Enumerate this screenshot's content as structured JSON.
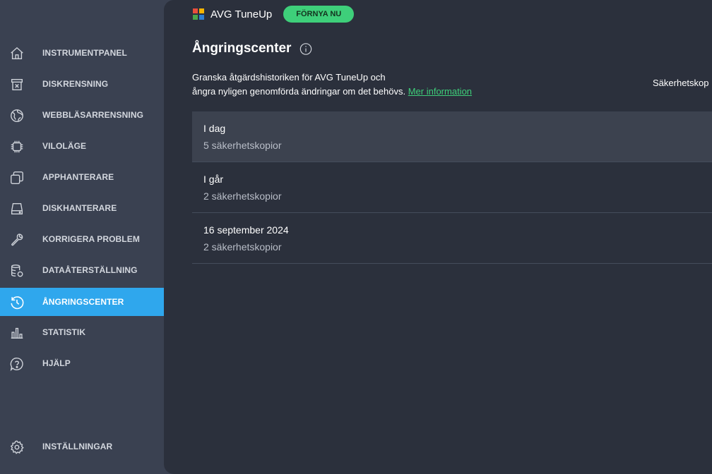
{
  "sidebar": {
    "items": [
      {
        "label": "INSTRUMENTPANEL",
        "icon": "home-icon"
      },
      {
        "label": "DISKRENSNING",
        "icon": "trash-icon"
      },
      {
        "label": "WEBBLÄSARRENSNING",
        "icon": "globe-icon"
      },
      {
        "label": "VILOLÄGE",
        "icon": "chip-icon"
      },
      {
        "label": "APPHANTERARE",
        "icon": "windows-icon"
      },
      {
        "label": "DISKHANTERARE",
        "icon": "drive-icon"
      },
      {
        "label": "KORRIGERA PROBLEM",
        "icon": "wrench-icon"
      },
      {
        "label": "DATAÅTERSTÄLLNING",
        "icon": "database-restore-icon"
      },
      {
        "label": "ÅNGRINGSCENTER",
        "icon": "history-icon",
        "active": true
      },
      {
        "label": "STATISTIK",
        "icon": "bar-chart-icon"
      },
      {
        "label": "HJÄLP",
        "icon": "help-icon"
      }
    ],
    "settings_label": "INSTÄLLNINGAR"
  },
  "header": {
    "brand": "AVG TuneUp",
    "renew_label": "FÖRNYA NU"
  },
  "main": {
    "title": "Ångringscenter",
    "description_line1": "Granska åtgärdshistoriken för AVG TuneUp och",
    "description_line2": "ångra nyligen genomförda ändringar om det behövs.",
    "more_info_link": "Mer information",
    "right_label": "Säkerhetskop",
    "history": [
      {
        "title": "I dag",
        "subtitle": "5 säkerhetskopior"
      },
      {
        "title": "I går",
        "subtitle": "2 säkerhetskopior"
      },
      {
        "title": "16 september 2024",
        "subtitle": "2 säkerhetskopior"
      }
    ]
  },
  "colors": {
    "sidebar_bg": "#3a4151",
    "main_bg": "#2b303c",
    "active_item": "#2fa7ed",
    "accent_green": "#3ecf7a"
  }
}
